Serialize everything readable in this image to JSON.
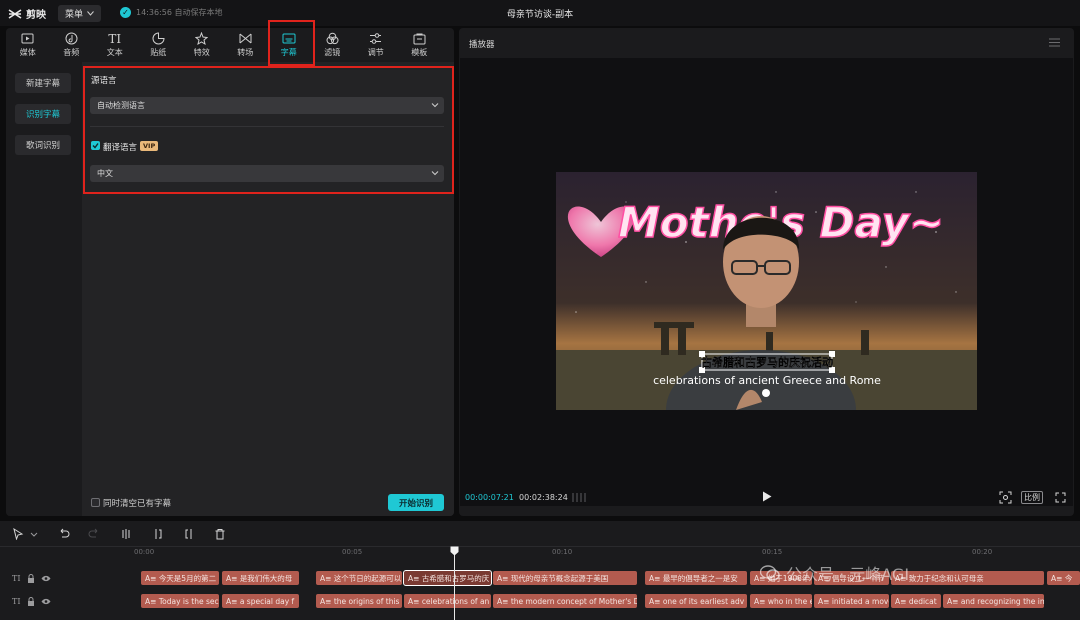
{
  "app": {
    "name": "剪映",
    "menu_label": "菜单",
    "autosave": "14:36:56 自动保存本地",
    "project_title": "母亲节访谈-副本"
  },
  "tools": [
    {
      "label": "媒体",
      "icon": "media-icon"
    },
    {
      "label": "音频",
      "icon": "audio-icon"
    },
    {
      "label": "文本",
      "icon": "text-icon"
    },
    {
      "label": "贴纸",
      "icon": "sticker-icon"
    },
    {
      "label": "特效",
      "icon": "effects-icon"
    },
    {
      "label": "转场",
      "icon": "transition-icon"
    },
    {
      "label": "字幕",
      "icon": "subtitle-icon"
    },
    {
      "label": "滤镜",
      "icon": "filter-icon"
    },
    {
      "label": "调节",
      "icon": "adjust-icon"
    },
    {
      "label": "模板",
      "icon": "template-icon"
    }
  ],
  "sidenav": {
    "new_subtitle": "新建字幕",
    "recognize_subtitle": "识别字幕",
    "lyrics_recognition": "歌词识别"
  },
  "recognize": {
    "source_label": "源语言",
    "source_value": "自动检测语言",
    "translate_label": "翻译语言",
    "vip_badge": "VIP",
    "translate_value": "中文",
    "clear_existing_label": "同时清空已有字幕",
    "start_button": "开始识别"
  },
  "player": {
    "title": "播放器",
    "current_time": "00:00:07:21",
    "total_time": "00:02:38:24",
    "ratio_label": "比例",
    "video_heading": "Mothe's Day~",
    "subtitle_cn": "古希腊和古罗马的庆祝活动",
    "subtitle_en": "celebrations of ancient Greece and Rome"
  },
  "timeline": {
    "ruler": [
      "00:00",
      "00:05",
      "00:10",
      "00:15",
      "00:20"
    ],
    "clip_icon": "A≡",
    "track1": [
      "今天是5月的第二",
      "是我们伟大的母",
      "这个节日的起源可以",
      "古希腊和古罗马的庆",
      "现代的母亲节概念起源于美国",
      "最早的倡导者之一是安",
      "她于1908年",
      "倡导设立一个节",
      "致力于纪念和认可母亲",
      "今"
    ],
    "track2": [
      "Today is the sec",
      "a special day f",
      "the origins of this",
      "celebrations of an",
      "the modern concept of Mother's D",
      "one of its earliest adv",
      "who in the ea",
      "initiated a move",
      "dedicat",
      "and recognizing the im"
    ],
    "watermark": "公众号 · 元峰AGI"
  },
  "colors": {
    "accent": "#1fc8d4",
    "highlight": "#e0231c",
    "clip": "#b35b4f"
  }
}
